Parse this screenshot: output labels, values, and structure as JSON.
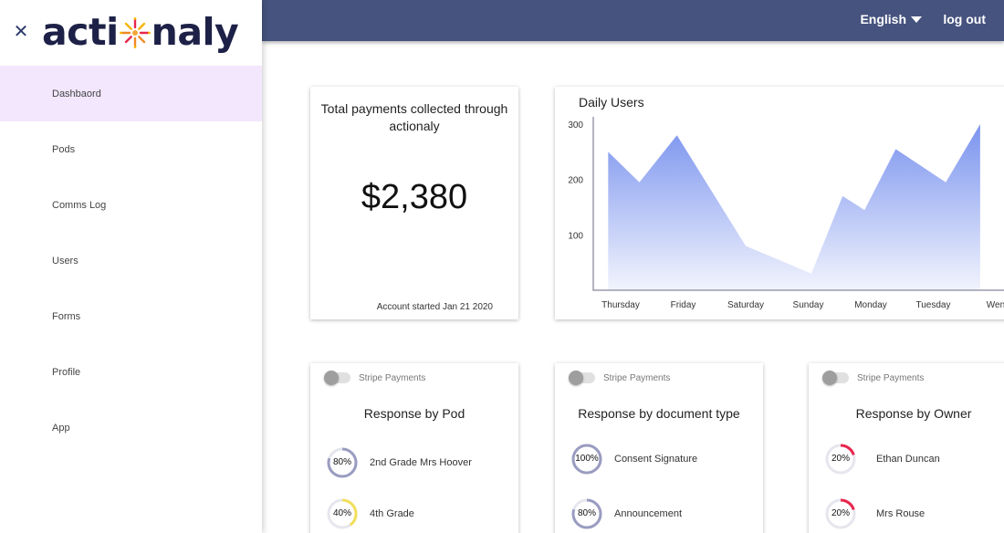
{
  "app": {
    "logo_left": "acti",
    "logo_right": "naly"
  },
  "sidebar": {
    "items": [
      {
        "label": "Dashbaord",
        "active": true
      },
      {
        "label": "Pods"
      },
      {
        "label": "Comms Log"
      },
      {
        "label": "Users"
      },
      {
        "label": "Forms"
      },
      {
        "label": "Profile"
      },
      {
        "label": "App"
      }
    ]
  },
  "topbar": {
    "language": "English",
    "logout": "log out"
  },
  "payments_card": {
    "title": "Total payments collected through actionaly",
    "amount": "$2,380",
    "account_started": "Account started Jan 21 2020"
  },
  "daily_users": {
    "title": "Daily Users",
    "chart_data": {
      "type": "area",
      "title": "Daily Users",
      "categories": [
        "Thursday",
        "Friday",
        "Saturday",
        "Sunday",
        "Monday",
        "Tuesday",
        "Wen"
      ],
      "x": [
        0,
        0.5,
        1,
        1.5,
        2,
        2.5,
        3,
        3.5,
        4,
        4.5,
        5,
        5.5,
        6,
        6.5
      ],
      "values": [
        250,
        195,
        280,
        80,
        30,
        170,
        145,
        255,
        195,
        300
      ],
      "points_x": [
        -0.2,
        0.3,
        0.9,
        2.0,
        3.05,
        3.55,
        3.9,
        4.4,
        5.2,
        5.75
      ],
      "yticks": [
        100,
        200,
        300
      ],
      "ylim": [
        0,
        310
      ],
      "fill_top": "#7a93ee",
      "fill_bottom": "#f2f4fd"
    }
  },
  "response_cards": [
    {
      "toggle_label": "Stripe Payments",
      "title": "Response by Pod",
      "items": [
        {
          "percent": "80%",
          "value": 0.8,
          "label": "2nd Grade Mrs Hoover",
          "color": "#9a9cc0"
        },
        {
          "percent": "40%",
          "value": 0.4,
          "label": "4th Grade",
          "color": "#f2df5a"
        }
      ]
    },
    {
      "toggle_label": "Stripe Payments",
      "title": "Response by document type",
      "items": [
        {
          "percent": "100%",
          "value": 1.0,
          "label": "Consent Signature",
          "color": "#9a9cc0"
        },
        {
          "percent": "80%",
          "value": 0.8,
          "label": "Announcement",
          "color": "#9a9cc0"
        }
      ]
    },
    {
      "toggle_label": "Stripe Payments",
      "title": "Response by Owner",
      "items": [
        {
          "percent": "20%",
          "value": 0.2,
          "label": "Ethan Duncan",
          "color": "#e8264d"
        },
        {
          "percent": "20%",
          "value": 0.2,
          "label": "Mrs Rouse",
          "color": "#e8264d"
        }
      ]
    }
  ]
}
